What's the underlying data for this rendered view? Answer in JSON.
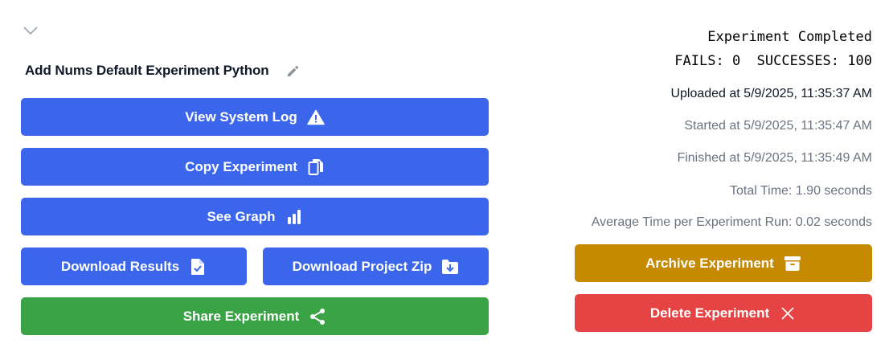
{
  "experiment": {
    "title": "Add Nums Default Experiment Python",
    "status": "Experiment Completed",
    "fails_label": "FAILS:",
    "fails_count": "0",
    "successes_label": "SUCCESSES:",
    "successes_count": "100"
  },
  "actions": {
    "view_log": "View System Log",
    "copy": "Copy Experiment",
    "see_graph": "See Graph",
    "download_results": "Download Results",
    "download_zip": "Download Project Zip",
    "share": "Share Experiment",
    "archive": "Archive Experiment",
    "delete": "Delete Experiment"
  },
  "times": {
    "uploaded": "Uploaded at 5/9/2025, 11:35:37 AM",
    "started": "Started at 5/9/2025, 11:35:47 AM",
    "finished": "Finished at 5/9/2025, 11:35:49 AM",
    "total": "Total Time: 1.90 seconds",
    "average": "Average Time per Experiment Run: 0.02 seconds"
  },
  "icons": {
    "collapse": "chevron-down-icon",
    "edit": "pencil-icon",
    "warning": "warning-icon",
    "copy": "copy-icon",
    "graph": "bar-chart-icon",
    "file_check": "file-check-icon",
    "folder_download": "folder-download-icon",
    "share": "share-icon",
    "archive": "archive-box-icon",
    "close": "close-icon"
  },
  "colors": {
    "primary": "#3b66ec",
    "success": "#39a346",
    "warning": "#c68a00",
    "danger": "#e64444"
  }
}
